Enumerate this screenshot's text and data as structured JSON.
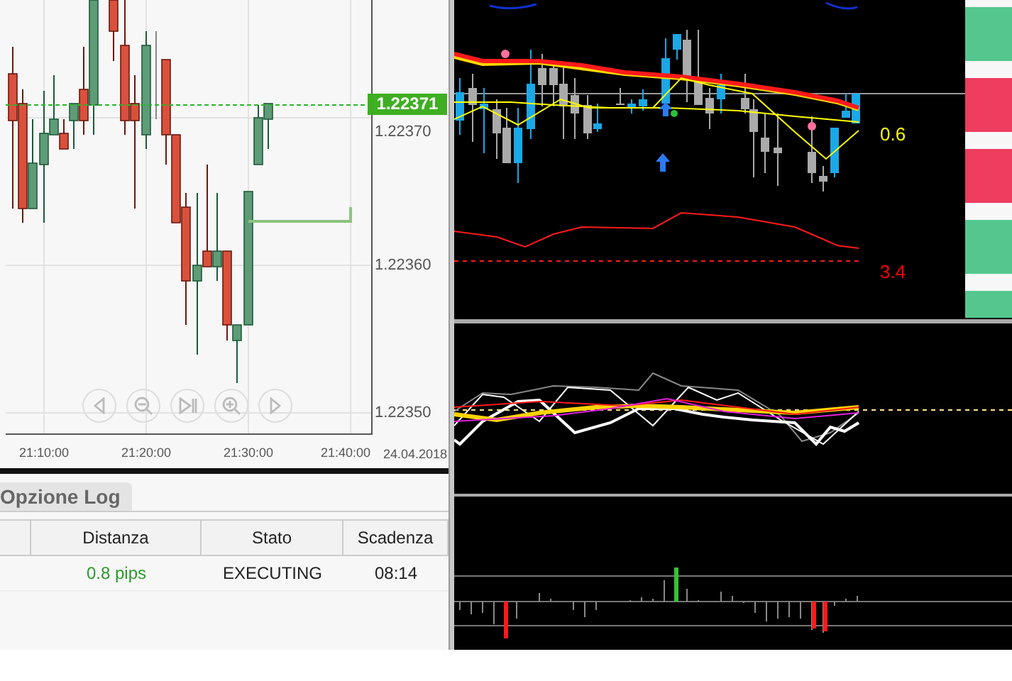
{
  "price_chart": {
    "current_price": "1.22371",
    "price_ticks": [
      "1.22370",
      "1.22360",
      "1.22350"
    ],
    "time_ticks": [
      "21:10:00",
      "21:20:00",
      "21:30:00",
      "21:40:00"
    ],
    "date": "24.04.2018"
  },
  "tabs": [
    {
      "label": "Opzione Log",
      "selected": true
    }
  ],
  "table": {
    "columns": [
      "Distanza",
      "Stato",
      "Scadenza"
    ],
    "rows": [
      {
        "cells": [
          "0.8 pips",
          "EXECUTING",
          "08:14"
        ]
      }
    ]
  },
  "indicator_chart": {
    "labels": [
      {
        "text": "0.6",
        "color": "#ffff00"
      },
      {
        "text": "3.4",
        "color": "#ff0000"
      }
    ]
  },
  "signal_stripes": [
    {
      "color": "#55c78e"
    },
    {
      "color": "#ee3d5f"
    },
    {
      "color": "#ee3d5f"
    },
    {
      "color": "#55c78e"
    },
    {
      "color": "#55c78e"
    }
  ]
}
